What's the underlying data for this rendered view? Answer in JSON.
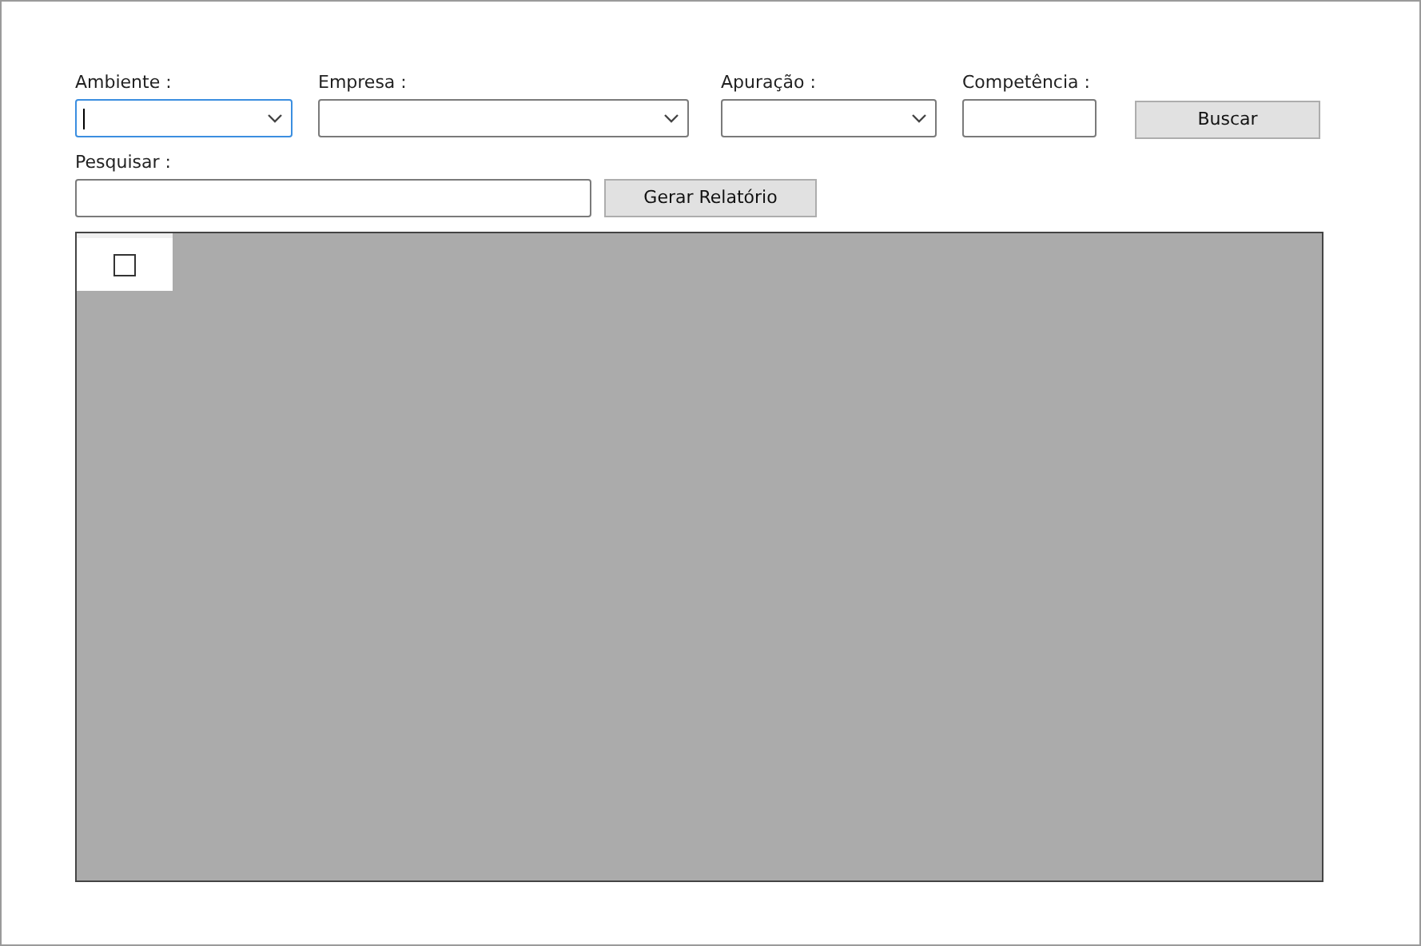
{
  "filters": [
    {
      "label": "Ambiente :",
      "kind": "combo",
      "focused": true
    },
    {
      "label": "Empresa :",
      "kind": "combo",
      "focused": false
    },
    {
      "label": "Apuração :",
      "kind": "combo",
      "focused": false
    },
    {
      "label": "Competência :",
      "kind": "text",
      "focused": false
    }
  ],
  "search_button": "Buscar",
  "search": {
    "label": "Pesquisar :"
  },
  "report_button": "Gerar Relatório",
  "grid": {
    "select_all_checked": false
  }
}
